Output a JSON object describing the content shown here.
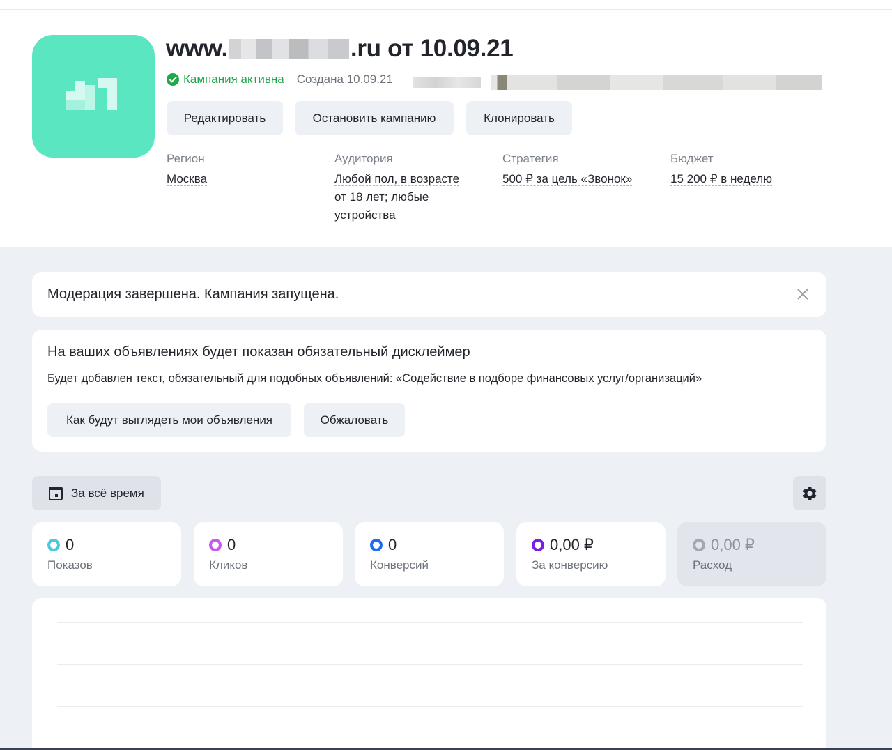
{
  "campaign": {
    "title_prefix": "www.",
    "title_suffix": ".ru от 10.09.21",
    "status": "Кампания активна",
    "created": "Создана 10.09.21"
  },
  "actions": {
    "edit": "Редактировать",
    "stop": "Остановить кампанию",
    "clone": "Клонировать"
  },
  "meta": {
    "region_label": "Регион",
    "region_value": "Москва",
    "audience_label": "Аудитория",
    "audience_value": [
      "Любой пол, в возрасте",
      "от 18 лет; любые",
      "устройства"
    ],
    "strategy_label": "Стратегия",
    "strategy_value": "500 ₽ за цель «Звонок»",
    "budget_label": "Бюджет",
    "budget_value": "15 200 ₽ в неделю"
  },
  "moderation": {
    "text": "Модерация завершена. Кампания запущена."
  },
  "disclaimer": {
    "title": "На ваших объявлениях будет показан обязательный дисклеймер",
    "text": "Будет добавлен текст, обязательный для подобных объявлений: «Содействие в подборе финансовых услуг/организаций»",
    "preview_button": "Как будут выглядеть мои объявления",
    "appeal_button": "Обжаловать"
  },
  "stats": {
    "period": "За всё время",
    "metrics": [
      {
        "value": "0",
        "label": "Показов",
        "color": "#4cc8de"
      },
      {
        "value": "0",
        "label": "Кликов",
        "color": "#c55bea"
      },
      {
        "value": "0",
        "label": "Конверсий",
        "color": "#1f6bf0"
      },
      {
        "value": "0,00 ₽",
        "label": "За конверсию",
        "color": "#7a1fe0"
      },
      {
        "value": "0,00 ₽",
        "label": "Расход",
        "color": "#a3a8af"
      }
    ]
  }
}
